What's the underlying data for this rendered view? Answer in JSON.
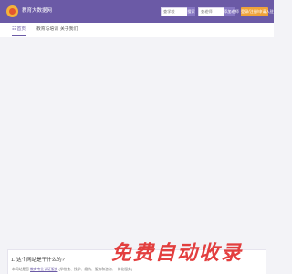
{
  "header": {
    "brand": "教育大数据网",
    "search_school_placeholder": "查学校",
    "search_school_button": "搜索",
    "search_teacher_placeholder": "查老师",
    "search_teacher_button": "添加老师",
    "login_button": "登录/注册/申请入驻"
  },
  "nav": {
    "home": "首页",
    "education": "教育与培训",
    "about": "关于我们"
  },
  "faq": {
    "question": "1. 这个网站是干什么的?",
    "answer_prefix": "本网站是您",
    "answer_link": "教育专业认证服务",
    "answer_suffix": "(学校查、找学、缴纳、服务和咨询, 一体化服务)"
  },
  "watermark": "免费自动收录",
  "colors": {
    "header_bg": "#6b5aa6",
    "accent": "#f0a33a",
    "watermark": "#e12f2f"
  }
}
